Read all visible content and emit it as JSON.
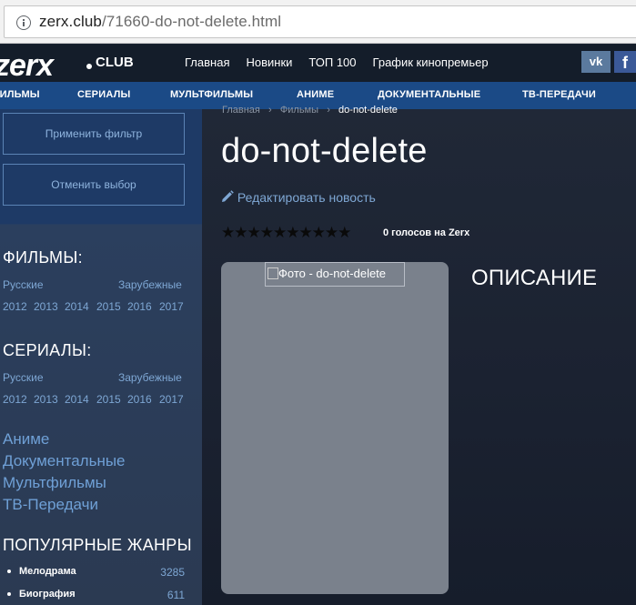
{
  "browser": {
    "url_host": "zerx.club",
    "url_path": "/71660-do-not-delete.html"
  },
  "header": {
    "logo": "zerx",
    "logo_suffix": "CLUB",
    "nav": [
      "Главная",
      "Новинки",
      "ТОП 100",
      "График кинопремьер"
    ],
    "social": {
      "vk": "vk",
      "fb": "f"
    }
  },
  "categories": [
    "ФИЛЬМЫ",
    "СЕРИАЛЫ",
    "МУЛЬТФИЛЬМЫ",
    "АНИМЕ",
    "ДОКУМЕНТАЛЬНЫЕ",
    "ТВ-ПЕРЕДАЧИ"
  ],
  "sidebar": {
    "apply_filter": "Применить фильтр",
    "reset_filter": "Отменить выбор",
    "films": {
      "heading": "ФИЛЬМЫ:",
      "russian": "Русские",
      "foreign": "Зарубежные",
      "years": [
        "2012",
        "2013",
        "2014",
        "2015",
        "2016",
        "2017"
      ]
    },
    "series": {
      "heading": "СЕРИАЛЫ:",
      "russian": "Русские",
      "foreign": "Зарубежные",
      "years": [
        "2012",
        "2013",
        "2014",
        "2015",
        "2016",
        "2017"
      ]
    },
    "links": [
      "Аниме",
      "Документальные",
      "Мультфильмы",
      "ТВ-Передачи"
    ],
    "genres_heading": "ПОПУЛЯРНЫЕ ЖАНРЫ",
    "genres": [
      {
        "name": "Мелодрама",
        "count": "3285"
      },
      {
        "name": "Биография",
        "count": "611"
      }
    ]
  },
  "main": {
    "breadcrumb": [
      "Главная",
      "Фильмы",
      "do-not-delete"
    ],
    "title": "do-not-delete",
    "edit_label": "Редактировать новость",
    "stars": "★★★★★★★★★★",
    "votes": "0 голосов на Zerx",
    "poster_alt": "Фото - do-not-delete",
    "description_heading": "ОПИСАНИЕ"
  }
}
